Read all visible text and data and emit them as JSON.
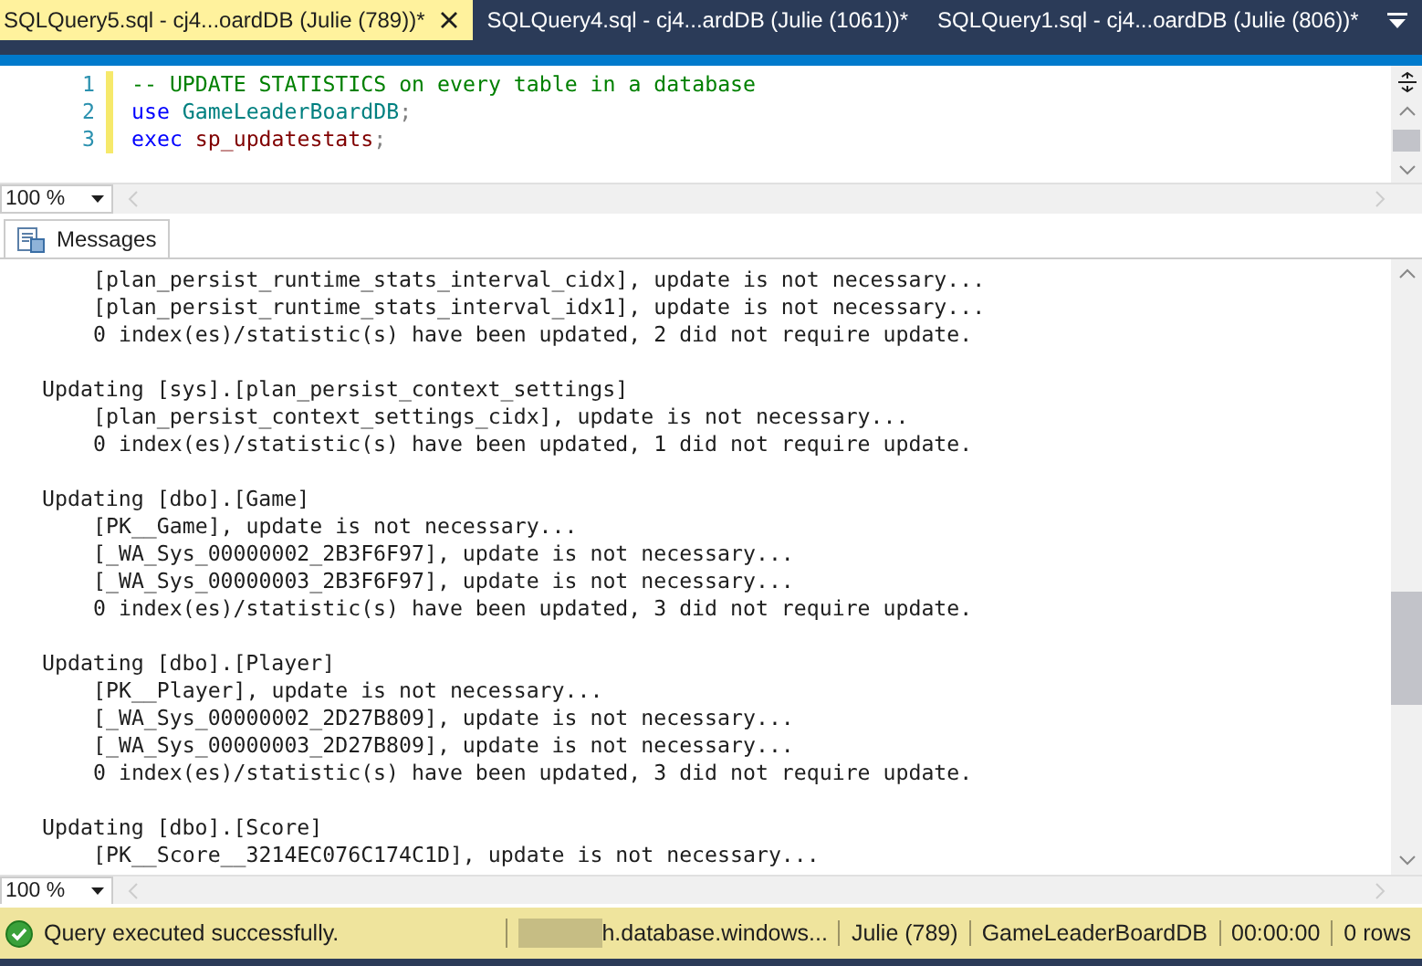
{
  "tabs": [
    {
      "label": "SQLQuery5.sql - cj4...oardDB (Julie (789))*",
      "selected": true
    },
    {
      "label": "SQLQuery4.sql - cj4...ardDB (Julie (1061))*",
      "selected": false
    },
    {
      "label": "SQLQuery1.sql - cj4...oardDB (Julie (806))*",
      "selected": false
    }
  ],
  "editor": {
    "lines": [
      {
        "number": "1",
        "tokens": [
          {
            "kind": "comment",
            "text": "-- UPDATE STATISTICS on every table in a database"
          }
        ]
      },
      {
        "number": "2",
        "tokens": [
          {
            "kind": "keyword",
            "text": "use"
          },
          {
            "kind": "plain",
            "text": " GameLeaderBoardDB"
          },
          {
            "kind": "punct",
            "text": ";"
          }
        ]
      },
      {
        "number": "3",
        "tokens": [
          {
            "kind": "keyword",
            "text": "exec"
          },
          {
            "kind": "proc",
            "text": " sp_updatestats"
          },
          {
            "kind": "punct",
            "text": ";"
          }
        ]
      }
    ],
    "zoom": "100 %"
  },
  "results": {
    "tabs": [
      {
        "label": "Messages",
        "selected": true
      }
    ],
    "lines": [
      {
        "kind": "detail",
        "text": "[plan_persist_runtime_stats_interval_cidx], update is not necessary..."
      },
      {
        "kind": "detail",
        "text": "[plan_persist_runtime_stats_interval_idx1], update is not necessary..."
      },
      {
        "kind": "detail",
        "text": "0 index(es)/statistic(s) have been updated, 2 did not require update."
      },
      {
        "kind": "blank"
      },
      {
        "kind": "header",
        "text": "Updating [sys].[plan_persist_context_settings]"
      },
      {
        "kind": "detail",
        "text": "[plan_persist_context_settings_cidx], update is not necessary..."
      },
      {
        "kind": "detail",
        "text": "0 index(es)/statistic(s) have been updated, 1 did not require update."
      },
      {
        "kind": "blank"
      },
      {
        "kind": "header",
        "text": "Updating [dbo].[Game]"
      },
      {
        "kind": "detail",
        "text": "[PK__Game], update is not necessary..."
      },
      {
        "kind": "detail",
        "text": "[_WA_Sys_00000002_2B3F6F97], update is not necessary..."
      },
      {
        "kind": "detail",
        "text": "[_WA_Sys_00000003_2B3F6F97], update is not necessary..."
      },
      {
        "kind": "detail",
        "text": "0 index(es)/statistic(s) have been updated, 3 did not require update."
      },
      {
        "kind": "blank"
      },
      {
        "kind": "header",
        "text": "Updating [dbo].[Player]"
      },
      {
        "kind": "detail",
        "text": "[PK__Player], update is not necessary..."
      },
      {
        "kind": "detail",
        "text": "[_WA_Sys_00000002_2D27B809], update is not necessary..."
      },
      {
        "kind": "detail",
        "text": "[_WA_Sys_00000003_2D27B809], update is not necessary..."
      },
      {
        "kind": "detail",
        "text": "0 index(es)/statistic(s) have been updated, 3 did not require update."
      },
      {
        "kind": "blank"
      },
      {
        "kind": "header",
        "text": "Updating [dbo].[Score]"
      },
      {
        "kind": "detail",
        "text": "[PK__Score__3214EC076C174C1D], update is not necessary..."
      }
    ],
    "zoom": "100 %"
  },
  "status_bar": {
    "message": "Query executed successfully.",
    "server": "h.database.windows...",
    "user": "Julie (789)",
    "database": "GameLeaderBoardDB",
    "elapsed": "00:00:00",
    "rows": "0 rows"
  }
}
